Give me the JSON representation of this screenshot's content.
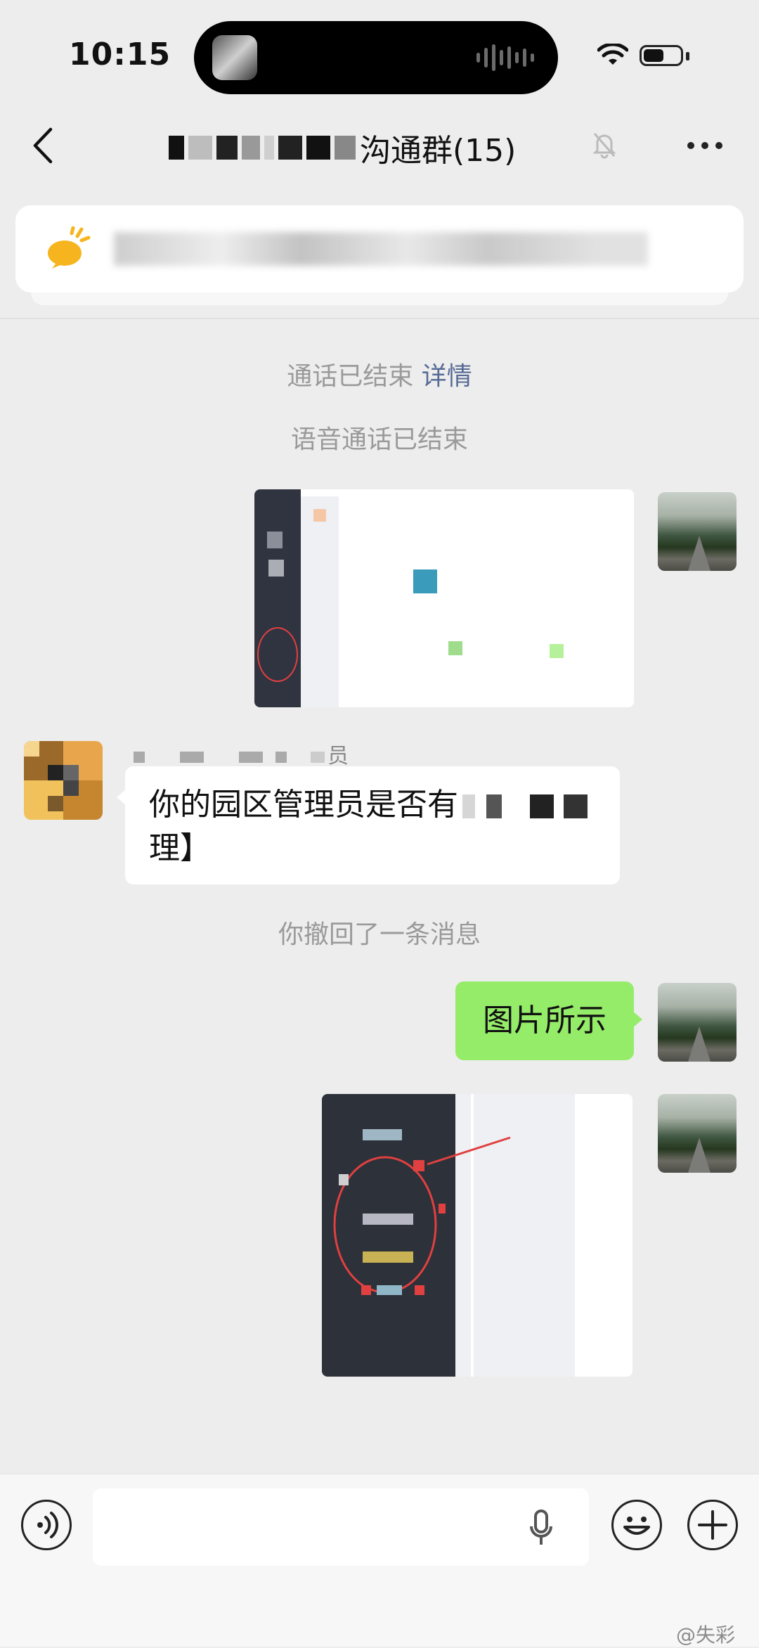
{
  "status_bar": {
    "time": "10:15",
    "icons": [
      "wifi-icon",
      "battery-icon"
    ]
  },
  "header": {
    "title": "沟通群(15)",
    "icons": [
      "back-icon",
      "mute-bell-icon",
      "more-icon"
    ]
  },
  "notice": {
    "icon": "speech-bubble-icon"
  },
  "messages": {
    "call_ended": "通话已结束",
    "call_details_link": "详情",
    "voice_call_ended": "语音通话已结束",
    "sender_name": "员",
    "incoming_text": "你的园区管理员是否有",
    "incoming_text_line2": "理】",
    "recalled": "你撤回了一条消息",
    "outgoing_text": "图片所示"
  },
  "input_bar": {
    "icons": [
      "voice-icon",
      "microphone-icon",
      "emoji-icon",
      "plus-icon"
    ]
  },
  "watermark": "@失彩",
  "colors": {
    "outgoing_bubble": "#95ec69",
    "link": "#576b95",
    "background": "#ededed"
  }
}
